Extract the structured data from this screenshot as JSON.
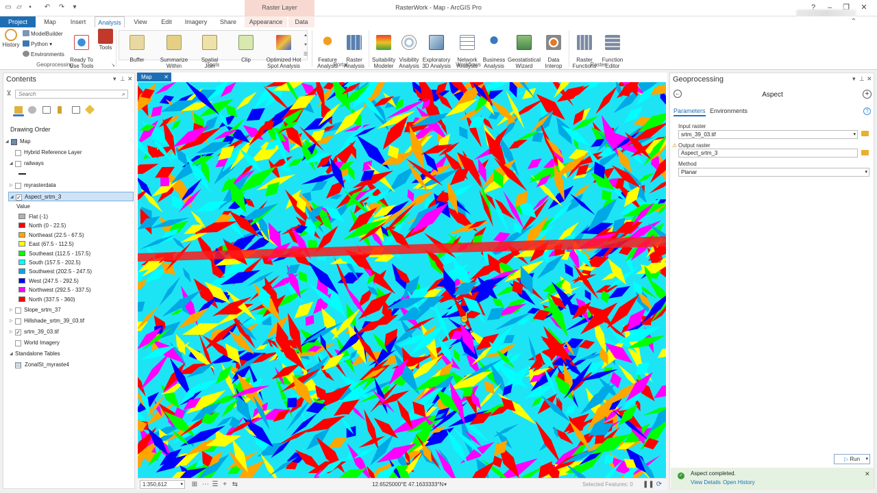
{
  "window": {
    "title": "RasterWork - Map - ArcGIS Pro",
    "context_tab_group": "Raster Layer",
    "help": "?"
  },
  "ribbon_tabs": [
    "Project",
    "Map",
    "Insert",
    "Analysis",
    "View",
    "Edit",
    "Imagery",
    "Share",
    "Appearance",
    "Data"
  ],
  "active_tab": "Analysis",
  "ribbon": {
    "geoprocessing": {
      "label": "Geoprocessing",
      "history": "History",
      "modelbuilder": "ModelBuilder",
      "python": "Python",
      "environments": "Environments",
      "ready_to_use": "Ready To\nUse Tools",
      "tools": "Tools"
    },
    "tools_group": {
      "label": "Tools",
      "items": [
        "Buffer",
        "Summarize\nWithin",
        "Spatial\nJoin",
        "Clip",
        "Optimized Hot\nSpot Analysis"
      ]
    },
    "portal": {
      "label": "Portal",
      "items": [
        "Feature\nAnalysis",
        "Raster\nAnalysis"
      ]
    },
    "workflows": {
      "label": "Workflows",
      "items": [
        "Suitability\nModeler",
        "Visibility\nAnalysis",
        "Exploratory\n3D Analysis",
        "Network\nAnalysis",
        "Business\nAnalysis",
        "Geostatistical\nWizard",
        "Data\nInterop"
      ]
    },
    "raster": {
      "label": "Raster",
      "items": [
        "Raster\nFunctions",
        "Function\nEditor"
      ]
    }
  },
  "contents": {
    "title": "Contents",
    "search_placeholder": "Search",
    "drawing_order": "Drawing Order",
    "layers": [
      {
        "label": "Map",
        "checked": true,
        "expanded": true
      },
      {
        "label": "Hybrid Reference Layer",
        "checked": false
      },
      {
        "label": "railways",
        "checked": false,
        "expanded": true
      },
      {
        "label": "myrasterdata",
        "checked": false
      },
      {
        "label": "Aspect_srtm_3",
        "checked": true,
        "expanded": true,
        "selected": true
      }
    ],
    "legend_header": "Value",
    "legend": [
      {
        "label": "Flat (-1)",
        "color": "#b2b2b2"
      },
      {
        "label": "North (0 - 22.5)",
        "color": "#ff0000"
      },
      {
        "label": "Northeast (22.5 - 67.5)",
        "color": "#ffa500"
      },
      {
        "label": "East (67.5 - 112.5)",
        "color": "#ffff00"
      },
      {
        "label": "Southeast (112.5 - 157.5)",
        "color": "#00ff00"
      },
      {
        "label": "South (157.5 - 202.5)",
        "color": "#00ffff"
      },
      {
        "label": "Southwest (202.5 - 247.5)",
        "color": "#00a9e6"
      },
      {
        "label": "West (247.5 - 292.5)",
        "color": "#0000ff"
      },
      {
        "label": "Northwest (292.5 - 337.5)",
        "color": "#ff00ff"
      },
      {
        "label": "North (337.5 - 360)",
        "color": "#ff0000"
      }
    ],
    "layers_after": [
      {
        "label": "Slope_srtm_37",
        "checked": false
      },
      {
        "label": "Hillshade_srtm_39_03.tif",
        "checked": false
      },
      {
        "label": "srtm_39_03.tif",
        "checked": true
      },
      {
        "label": "World Imagery",
        "checked": false
      }
    ],
    "standalone_tables": "Standalone Tables",
    "table": "ZonalSt_myraste4"
  },
  "map": {
    "tab": "Map",
    "scale": "1:350,612",
    "coordinates": "12.6525000°E 47.1633333°N",
    "selected_features": "Selected Features: 0",
    "aspect_colors": [
      "#ff0000",
      "#ffa500",
      "#ffff00",
      "#00ff00",
      "#00ffff",
      "#00a9e6",
      "#0000ff",
      "#ff00ff",
      "#ff0000"
    ]
  },
  "geoprocessing": {
    "title": "Geoprocessing",
    "tool": "Aspect",
    "tabs": [
      "Parameters",
      "Environments"
    ],
    "input_raster_label": "Input raster",
    "input_raster": "srtm_39_03.tif",
    "output_raster_label": "Output raster",
    "output_raster": "Aspect_srtm_3",
    "method_label": "Method",
    "method": "Planar",
    "run": "Run",
    "status": "Aspect completed.",
    "view_details": "View Details",
    "open_history": "Open History"
  }
}
